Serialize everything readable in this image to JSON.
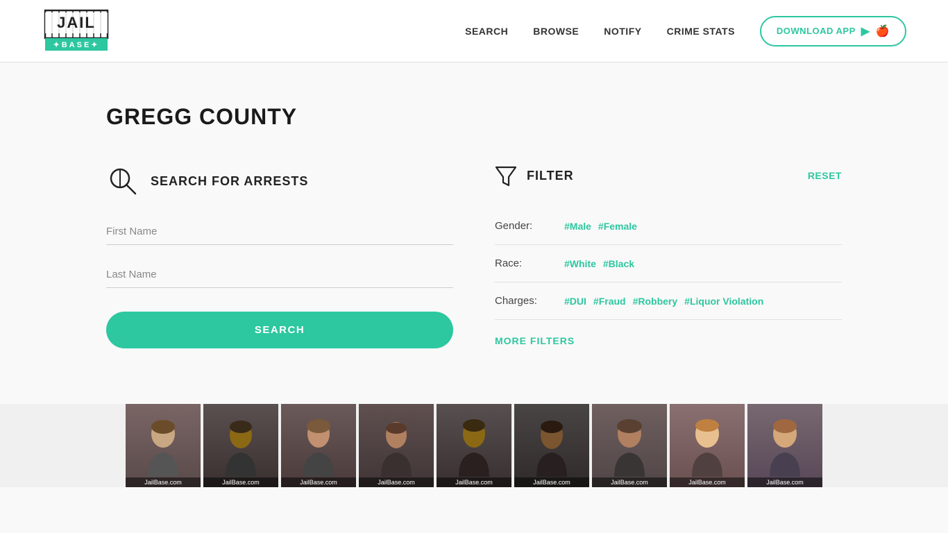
{
  "header": {
    "logo_text": "JAIL BASE",
    "nav": {
      "search_label": "SEARCH",
      "browse_label": "BROWSE",
      "notify_label": "NOTIFY",
      "crime_stats_label": "CRIME STATS",
      "download_label": "DOWNLOAD APP"
    }
  },
  "main": {
    "page_title": "GREGG COUNTY",
    "search_section": {
      "heading": "SEARCH FOR ARRESTS",
      "first_name_placeholder": "First Name",
      "last_name_placeholder": "Last Name",
      "search_button_label": "SEARCH"
    },
    "filter_section": {
      "heading": "FILTER",
      "reset_label": "RESET",
      "gender_label": "Gender:",
      "gender_options": [
        "#Male",
        "#Female"
      ],
      "race_label": "Race:",
      "race_options": [
        "#White",
        "#Black"
      ],
      "charges_label": "Charges:",
      "charges_options": [
        "#DUI",
        "#Fraud",
        "#Robbery",
        "#Liquor Violation"
      ],
      "more_filters_label": "MORE FILTERS"
    },
    "photo_strip": {
      "watermark": "JailBase.com",
      "count": 9
    }
  },
  "colors": {
    "accent": "#2dc7a0",
    "text_dark": "#1a1a1a",
    "text_medium": "#444",
    "border": "#e0e0e0"
  }
}
